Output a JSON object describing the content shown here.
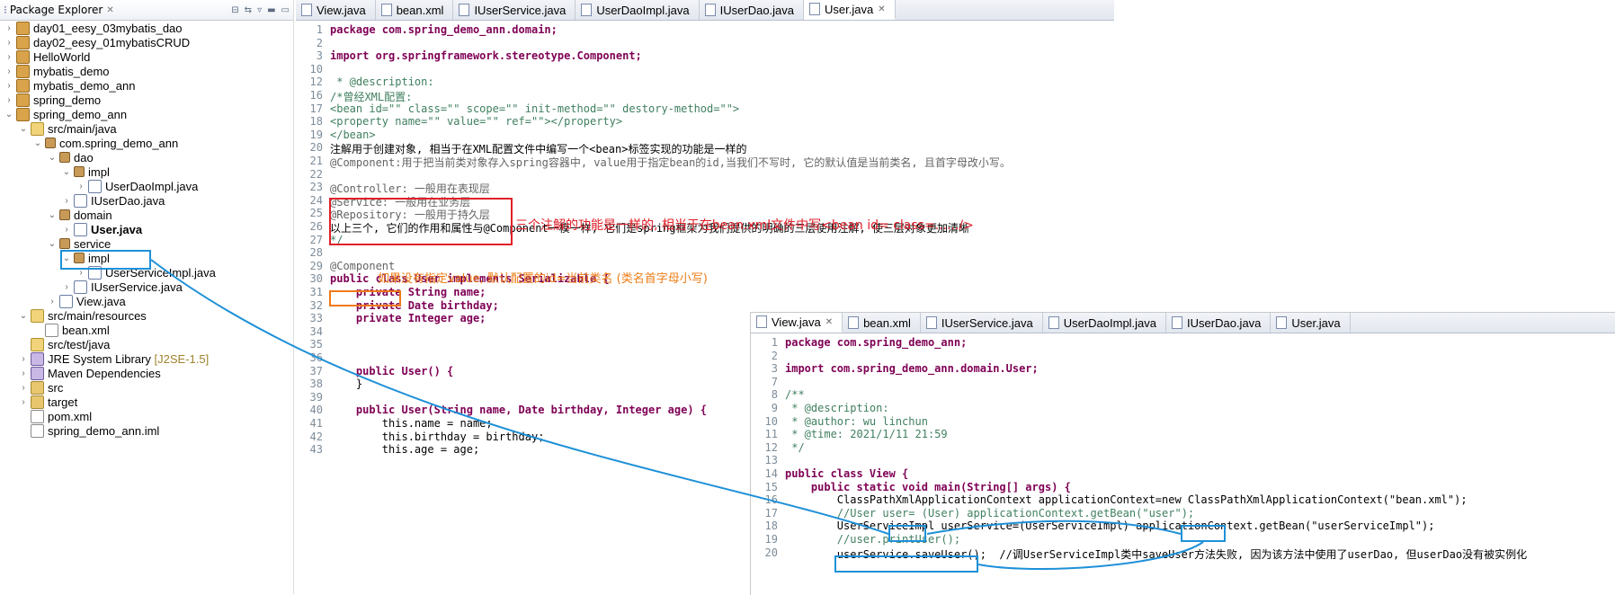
{
  "explorer": {
    "title": "Package Explorer",
    "items": [
      {
        "label": "day01_eesy_03mybatis_dao"
      },
      {
        "label": "day02_eesy_01mybatisCRUD"
      },
      {
        "label": "HelloWorld"
      },
      {
        "label": "mybatis_demo"
      },
      {
        "label": "mybatis_demo_ann"
      },
      {
        "label": "spring_demo"
      },
      {
        "label": "spring_demo_ann"
      },
      {
        "label": "src/main/java"
      },
      {
        "label": "com.spring_demo_ann"
      },
      {
        "label": "dao"
      },
      {
        "label": "impl"
      },
      {
        "label": "UserDaoImpl.java"
      },
      {
        "label": "IUserDao.java"
      },
      {
        "label": "domain"
      },
      {
        "label": "User.java"
      },
      {
        "label": "service"
      },
      {
        "label": "impl"
      },
      {
        "label": "UserServiceImpl.java"
      },
      {
        "label": "IUserService.java"
      },
      {
        "label": "View.java"
      },
      {
        "label": "src/main/resources"
      },
      {
        "label": "bean.xml"
      },
      {
        "label": "src/test/java"
      },
      {
        "label": "JRE System Library",
        "suffix": "[J2SE-1.5]"
      },
      {
        "label": "Maven Dependencies"
      },
      {
        "label": "src"
      },
      {
        "label": "target"
      },
      {
        "label": "pom.xml"
      },
      {
        "label": "spring_demo_ann.iml"
      }
    ]
  },
  "editor_top": {
    "tabs": [
      "View.java",
      "bean.xml",
      "IUserService.java",
      "UserDaoImpl.java",
      "IUserDao.java",
      "User.java"
    ],
    "active_tab": "User.java",
    "lines": [
      {
        "n": "1",
        "t": "package com.spring_demo_ann.domain;"
      },
      {
        "n": "2",
        "t": ""
      },
      {
        "n": "3",
        "t": "import org.springframework.stereotype.Component;"
      },
      {
        "n": "10",
        "t": ""
      },
      {
        "n": "12",
        "t": " * @description:"
      },
      {
        "n": "16",
        "t": "/*曾经XML配置:"
      },
      {
        "n": "17",
        "t": "<bean id=\"\" class=\"\" scope=\"\" init-method=\"\" destory-method=\"\">"
      },
      {
        "n": "18",
        "t": "<property name=\"\" value=\"\" ref=\"\"></property>"
      },
      {
        "n": "19",
        "t": "</bean>"
      },
      {
        "n": "20",
        "t": "注解用于创建对象, 相当于在XML配置文件中编写一个<bean>标签实现的功能是一样的"
      },
      {
        "n": "21",
        "t": "@Component:用于把当前类对象存入spring容器中, value用于指定bean的id,当我们不写时, 它的默认值是当前类名, 且首字母改小写。"
      },
      {
        "n": "22",
        "t": ""
      },
      {
        "n": "23",
        "t": "@Controller: 一般用在表现层"
      },
      {
        "n": "24",
        "t": "@Service: 一般用在业务层"
      },
      {
        "n": "25",
        "t": "@Repository: 一般用于持久层"
      },
      {
        "n": "26",
        "t": "以上三个, 它们的作用和属性与@Component一模一样, 它们是spring框架为我们提供的明确的三层使用注解, 使三层对象更加清晰"
      },
      {
        "n": "27",
        "t": "*/"
      },
      {
        "n": "28",
        "t": ""
      },
      {
        "n": "29",
        "t": "@Component"
      },
      {
        "n": "30",
        "t": "public class User implements Serializable {"
      },
      {
        "n": "31",
        "t": "    private String name;"
      },
      {
        "n": "32",
        "t": "    private Date birthday;"
      },
      {
        "n": "33",
        "t": "    private Integer age;"
      },
      {
        "n": "34",
        "t": ""
      },
      {
        "n": "35",
        "t": ""
      },
      {
        "n": "36",
        "t": ""
      },
      {
        "n": "37",
        "t": "    public User() {"
      },
      {
        "n": "38",
        "t": "    }"
      },
      {
        "n": "39",
        "t": ""
      },
      {
        "n": "40",
        "t": "    public User(String name, Date birthday, Integer age) {"
      },
      {
        "n": "41",
        "t": "        this.name = name;"
      },
      {
        "n": "42",
        "t": "        this.birthday = birthday;"
      },
      {
        "n": "43",
        "t": "        this.age = age;"
      }
    ]
  },
  "annotations": {
    "three_annotations_note": "三个注解的功能是一样的, 相当于在bean.xml文件中写<bean id= class=....../>",
    "value_note": "如果没有指定value, 默认配置的id=当前类名 (类名首字母小写)"
  },
  "editor_bottom": {
    "tabs": [
      "View.java",
      "bean.xml",
      "IUserService.java",
      "UserDaoImpl.java",
      "IUserDao.java",
      "User.java"
    ],
    "active_tab": "View.java",
    "lines": [
      {
        "n": "1",
        "t": "package com.spring_demo_ann;"
      },
      {
        "n": "2",
        "t": ""
      },
      {
        "n": "3",
        "t": "import com.spring_demo_ann.domain.User;"
      },
      {
        "n": "7",
        "t": ""
      },
      {
        "n": "8",
        "t": "/**"
      },
      {
        "n": "9",
        "t": " * @description:"
      },
      {
        "n": "10",
        "t": " * @author: wu linchun"
      },
      {
        "n": "11",
        "t": " * @time: 2021/1/11 21:59"
      },
      {
        "n": "12",
        "t": " */"
      },
      {
        "n": "13",
        "t": ""
      },
      {
        "n": "14",
        "t": "public class View {"
      },
      {
        "n": "15",
        "t": "    public static void main(String[] args) {"
      },
      {
        "n": "16",
        "t": "        ClassPathXmlApplicationContext applicationContext=new ClassPathXmlApplicationContext(\"bean.xml\");"
      },
      {
        "n": "17",
        "t": "        //User user= (User) applicationContext.getBean(\"user\");"
      },
      {
        "n": "18",
        "t": "        UserServiceImpl userService=(UserServiceImpl) applicationContext.getBean(\"userServiceImpl\");"
      },
      {
        "n": "19",
        "t": "        //user.printUser();"
      },
      {
        "n": "20",
        "t": "        userService.saveUser();  //调UserServiceImpl类中saveUser方法失败, 因为该方法中使用了userDao, 但userDao没有被实例化"
      }
    ]
  },
  "colors": {
    "red_box": "#e0202a",
    "blue_box": "#1e90d8",
    "orange_box": "#f07a1a",
    "red_note": "#e0202a",
    "orange_note": "#ee7d16"
  }
}
